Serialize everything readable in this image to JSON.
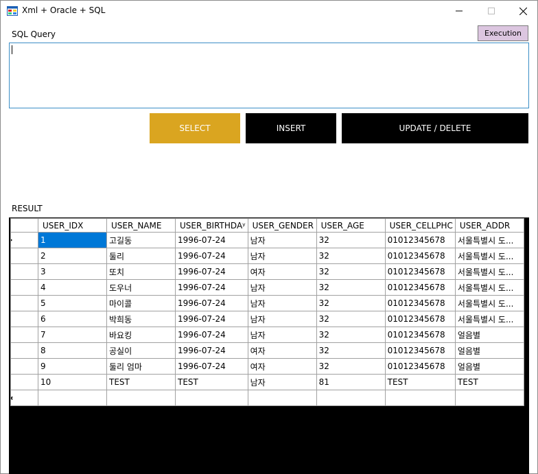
{
  "window": {
    "title": "Xml + Oracle + SQL"
  },
  "labels": {
    "sql_query": "SQL Query",
    "result": "RESULT"
  },
  "buttons": {
    "execution": "Execution",
    "select": "SELECT",
    "insert": "INSERT",
    "update_delete": "UPDATE / DELETE"
  },
  "query": {
    "value": ""
  },
  "colors": {
    "select_button": "#daa520",
    "execution_button": "#dcc6e0",
    "dark_button": "#000000",
    "selection": "#0078d7"
  },
  "grid": {
    "columns": [
      "USER_IDX",
      "USER_NAME",
      "USER_BIRTHDAY",
      "USER_GENDER",
      "USER_AGE",
      "USER_CELLPHONE",
      "USER_ADDR"
    ],
    "column_display": [
      "USER_IDX",
      "USER_NAME",
      "USER_BIRTHDAʸ",
      "USER_GENDER",
      "USER_AGE",
      "USER_CELLPHC",
      "USER_ADDR"
    ],
    "rows": [
      [
        "1",
        "고길동",
        "1996-07-24",
        "남자",
        "32",
        "01012345678",
        "서울특별시 도..."
      ],
      [
        "2",
        "둘리",
        "1996-07-24",
        "남자",
        "32",
        "01012345678",
        "서울특별시 도..."
      ],
      [
        "3",
        "또치",
        "1996-07-24",
        "여자",
        "32",
        "01012345678",
        "서울특별시 도..."
      ],
      [
        "4",
        "도우너",
        "1996-07-24",
        "남자",
        "32",
        "01012345678",
        "서울특별시 도..."
      ],
      [
        "5",
        "마이콜",
        "1996-07-24",
        "남자",
        "32",
        "01012345678",
        "서울특별시 도..."
      ],
      [
        "6",
        "박희동",
        "1996-07-24",
        "남자",
        "32",
        "01012345678",
        "서울특별시 도..."
      ],
      [
        "7",
        "바요킹",
        "1996-07-24",
        "남자",
        "32",
        "01012345678",
        "얼음별"
      ],
      [
        "8",
        "공실이",
        "1996-07-24",
        "여자",
        "32",
        "01012345678",
        "얼음별"
      ],
      [
        "9",
        "둘리 엄마",
        "1996-07-24",
        "여자",
        "32",
        "01012345678",
        "얼음별"
      ],
      [
        "10",
        "TEST",
        "TEST",
        "남자",
        "81",
        "TEST",
        "TEST"
      ]
    ]
  }
}
